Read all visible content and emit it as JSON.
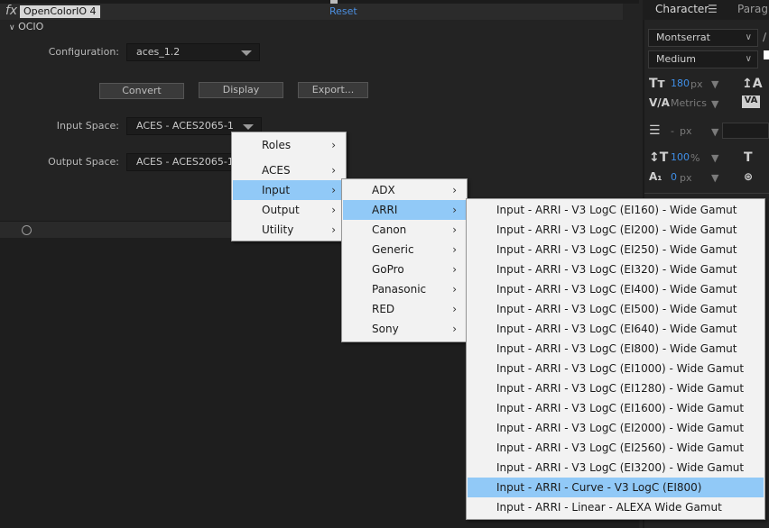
{
  "effect_controls": {
    "effect_name": "OpenColorIO 4",
    "fx_label": "fx",
    "reset_label": "Reset",
    "group_label": "OCIO",
    "configuration_label": "Configuration:",
    "configuration_value": "aces_1.2",
    "buttons": {
      "convert": "Convert",
      "display": "Display",
      "export": "Export..."
    },
    "input_space_label": "Input Space:",
    "input_space_value": "ACES - ACES2065-1",
    "output_space_label": "Output Space:",
    "output_space_value": "ACES - ACES2065-1"
  },
  "character_panel": {
    "tab_character": "Character",
    "tab_paragraph": "Paragra",
    "font_family": "Montserrat",
    "font_style": "Medium",
    "font_size": "180",
    "font_size_unit": "px",
    "leading": "Metrics",
    "stroke_width": "-",
    "stroke_unit": "px",
    "vertical_scale": "100",
    "vertical_scale_unit": "%",
    "baseline_shift": "0",
    "baseline_unit": "px"
  },
  "menus": {
    "level1": [
      "Roles",
      "ACES",
      "Input",
      "Output",
      "Utility"
    ],
    "level1_selected": "Input",
    "level2": [
      "ADX",
      "ARRI",
      "Canon",
      "Generic",
      "GoPro",
      "Panasonic",
      "RED",
      "Sony"
    ],
    "level2_selected": "ARRI",
    "level3": [
      "Input - ARRI - V3 LogC (EI160) - Wide Gamut",
      "Input - ARRI - V3 LogC (EI200) - Wide Gamut",
      "Input - ARRI - V3 LogC (EI250) - Wide Gamut",
      "Input - ARRI - V3 LogC (EI320) - Wide Gamut",
      "Input - ARRI - V3 LogC (EI400) - Wide Gamut",
      "Input - ARRI - V3 LogC (EI500) - Wide Gamut",
      "Input - ARRI - V3 LogC (EI640) - Wide Gamut",
      "Input - ARRI - V3 LogC (EI800) - Wide Gamut",
      "Input - ARRI - V3 LogC (EI1000) - Wide Gamut",
      "Input - ARRI - V3 LogC (EI1280) - Wide Gamut",
      "Input - ARRI - V3 LogC (EI1600) - Wide Gamut",
      "Input - ARRI - V3 LogC (EI2000) - Wide Gamut",
      "Input - ARRI - V3 LogC (EI2560) - Wide Gamut",
      "Input - ARRI - V3 LogC (EI3200) - Wide Gamut",
      "Input - ARRI - Curve - V3 LogC (EI800)",
      "Input - ARRI - Linear - ALEXA Wide Gamut"
    ],
    "level3_selected": "Input - ARRI - Curve - V3 LogC (EI800)"
  }
}
